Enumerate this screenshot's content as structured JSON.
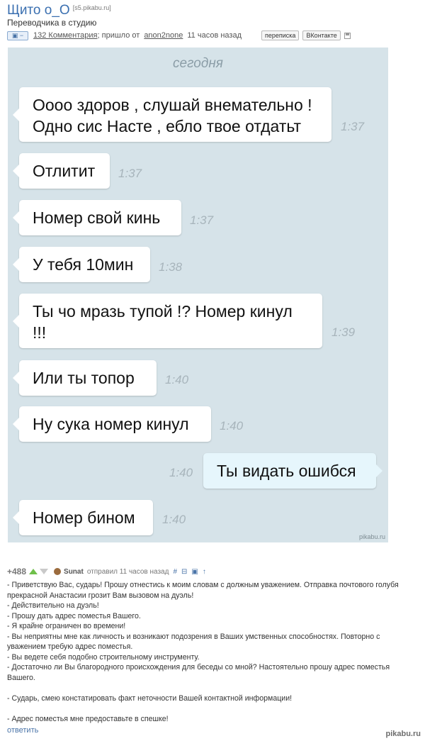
{
  "post": {
    "title": "Щито о_О",
    "host": "[s5.pikabu.ru]",
    "subtitle": "Переводчика в студию",
    "camera_label": "▣ −",
    "comments_link": "132 Комментария",
    "meta_mid": "; пришло от",
    "author": "anon2none",
    "time": "11 часов назад",
    "btn_message": "переписка",
    "btn_vk": "ВКонтакте"
  },
  "chat": {
    "day_label": "сегодня",
    "watermark": "pikabu.ru",
    "messages": [
      {
        "text": "Оооо здоров , слушай внемательно ! Одно сис Насте , ебло твое отдатьт",
        "time": "1:37",
        "direction": "in"
      },
      {
        "text": "Отлитит",
        "time": "1:37",
        "direction": "in"
      },
      {
        "text": "Номер свой кинь",
        "time": "1:37",
        "direction": "in"
      },
      {
        "text": "У тебя 10мин",
        "time": "1:38",
        "direction": "in"
      },
      {
        "text": "Ты чо мразь тупой !? Номер кинул !!!",
        "time": "1:39",
        "direction": "in"
      },
      {
        "text": "Или ты  топор",
        "time": "1:40",
        "direction": "in"
      },
      {
        "text": "Ну сука номер кинул",
        "time": "1:40",
        "direction": "in"
      },
      {
        "text": "Ты видать ошибся",
        "time": "1:40",
        "direction": "out"
      },
      {
        "text": "Номер бином",
        "time": "1:40",
        "direction": "in"
      }
    ]
  },
  "comment": {
    "rating": "+488",
    "author": "Sunat",
    "posted": "отправил 11 часов назад",
    "icon_hash": "#",
    "icon_minus": "⊟",
    "icon_save": "▣",
    "icon_up": "↑",
    "lines": [
      "- Приветствую Вас, сударь! Прошу отнестись к моим словам с должным уважением. Отправка почтового голубя прекрасной Анастасии грозит Вам вызовом на дуэль!",
      "- Действительно на дуэль!",
      "- Прошу дать адрес поместья Вашего.",
      "- Я крайне ограничен во времени!",
      "- Вы неприятны мне как личность и возникают подозрения в Ваших умственных способностях. Повторно с уважением требую адрес поместья.",
      "- Вы ведете себя подобно строительному инструменту.",
      "- Достаточно ли Вы благородного происхождения для беседы со мной? Настоятельно прошу адрес поместья Вашего.",
      "",
      "- Сударь, смею констатировать факт неточности Вашей контактной информации!",
      "",
      "- Адрес поместья мне предоставьте в спешке!"
    ],
    "reply_label": "ответить",
    "footer_mark": "pikabu.ru"
  }
}
